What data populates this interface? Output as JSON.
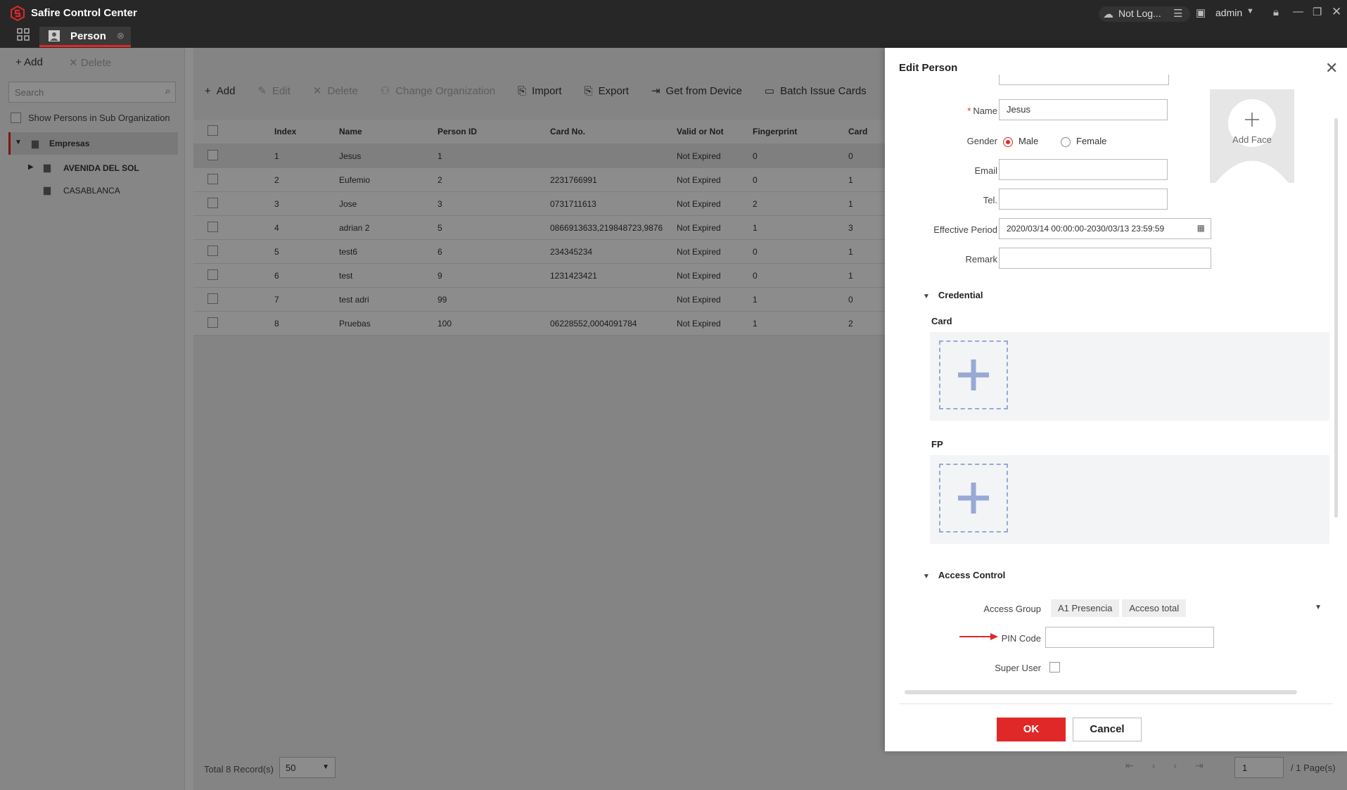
{
  "app": {
    "title": "Safire Control Center",
    "status": "Not Log...",
    "user": "admin",
    "tab": "Person"
  },
  "left_panel": {
    "add_label": "Add",
    "delete_label": "Delete",
    "search_placeholder": "Search",
    "show_sub_label": "Show Persons in Sub Organization",
    "tree": [
      {
        "label": "Empresas"
      },
      {
        "label": "AVENIDA DEL SOL"
      },
      {
        "label": "CASABLANCA"
      }
    ]
  },
  "toolbar": {
    "add": "Add",
    "edit": "Edit",
    "delete": "Delete",
    "change_org": "Change Organization",
    "import": "Import",
    "export": "Export",
    "get_device": "Get from Device",
    "batch_issue": "Batch Issue Cards"
  },
  "table": {
    "headers": [
      "Index",
      "Name",
      "Person ID",
      "Card No.",
      "Valid or Not",
      "Fingerprint",
      "Card"
    ],
    "rows": [
      [
        "1",
        "Jesus",
        "1",
        "",
        "Not Expired",
        "0",
        "0"
      ],
      [
        "2",
        "Eufemio",
        "2",
        "2231766991",
        "Not Expired",
        "0",
        "1"
      ],
      [
        "3",
        "Jose",
        "3",
        "0731711613",
        "Not Expired",
        "2",
        "1"
      ],
      [
        "4",
        "adrian 2",
        "5",
        "0866913633,219848723,9876",
        "Not Expired",
        "1",
        "3"
      ],
      [
        "5",
        "test6",
        "6",
        "234345234",
        "Not Expired",
        "0",
        "1"
      ],
      [
        "6",
        "test",
        "9",
        "1231423421",
        "Not Expired",
        "0",
        "1"
      ],
      [
        "7",
        "test adri",
        "99",
        "",
        "Not Expired",
        "1",
        "0"
      ],
      [
        "8",
        "Pruebas",
        "100",
        "06228552,0004091784",
        "Not Expired",
        "1",
        "2"
      ]
    ]
  },
  "footer": {
    "total": "Total 8 Record(s)",
    "page_size": "50",
    "page": "1",
    "pages": "/ 1 Page(s)"
  },
  "dialog": {
    "title": "Edit Person",
    "name_label": "Name",
    "name_value": "Jesus",
    "gender_label": "Gender",
    "male": "Male",
    "female": "Female",
    "email_label": "Email",
    "tel_label": "Tel.",
    "period_label": "Effective Period",
    "period_value": "2020/03/14 00:00:00-2030/03/13 23:59:59",
    "remark_label": "Remark",
    "add_face": "Add Face",
    "credential": "Credential",
    "card": "Card",
    "fp": "FP",
    "access_control": "Access Control",
    "access_group_label": "Access Group",
    "access_groups": [
      "A1 Presencia",
      "Acceso total"
    ],
    "pin_label": "PIN Code",
    "super_user_label": "Super User",
    "ok": "OK",
    "cancel": "Cancel"
  }
}
